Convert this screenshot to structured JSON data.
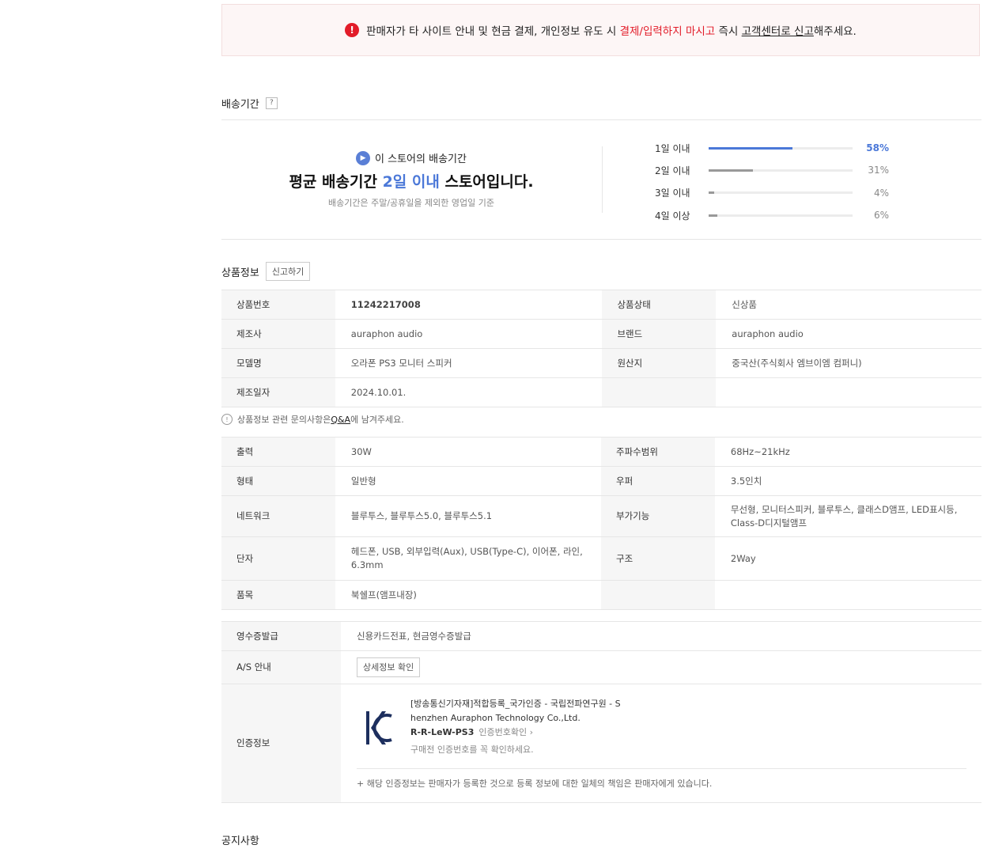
{
  "warning": {
    "icon": "alert-icon",
    "text_a": "판매자가 타 사이트 안내 및 현금 결제, 개인정보 유도 시 ",
    "text_red": "결제/입력하지 마시고",
    "text_b": " 즉시 ",
    "text_ul": "고객센터로 신고",
    "text_c": "해주세요."
  },
  "delivery": {
    "title": "배송기간",
    "help": "?",
    "sub": "이 스토어의 배송기간",
    "big_a": "평균 배송기간 ",
    "big_hl": "2일 이내",
    "big_b": " 스토어입니다.",
    "note": "배송기간은 주말/공휴일을 제외한 영업일 기준",
    "bars": [
      {
        "label": "1일 이내",
        "pct_text": "58%",
        "value": 58
      },
      {
        "label": "2일 이내",
        "pct_text": "31%",
        "value": 31
      },
      {
        "label": "3일 이내",
        "pct_text": "4%",
        "value": 4
      },
      {
        "label": "4일 이상",
        "pct_text": "6%",
        "value": 6
      }
    ]
  },
  "product": {
    "title": "상품정보",
    "report": "신고하기",
    "rows1": [
      [
        "상품번호",
        "11242217008",
        "상품상태",
        "신상품"
      ],
      [
        "제조사",
        "auraphon audio",
        "브랜드",
        "auraphon audio"
      ],
      [
        "모델명",
        "오라폰 PS3 모니터 스피커",
        "원산지",
        "중국산(주식회사 엠브이엠 컴퍼니)"
      ],
      [
        "제조일자",
        "2024.10.01.",
        "",
        ""
      ]
    ],
    "qa_a": "상품정보 관련 문의사항은 ",
    "qa_link": "Q&A",
    "qa_b": "에 남겨주세요.",
    "rows2": [
      [
        "출력",
        "30W",
        "주파수범위",
        "68Hz~21kHz"
      ],
      [
        "형태",
        "일반형",
        "우퍼",
        "3.5인치"
      ],
      [
        "네트워크",
        "블루투스, 블루투스5.0, 블루투스5.1",
        "부가기능",
        "무선형, 모니터스피커, 블루투스, 클래스D앰프, LED표시등, Class-D디지털앰프"
      ],
      [
        "단자",
        "헤드폰, USB, 외부입력(Aux), USB(Type-C), 이어폰, 라인, 6.3mm",
        "구조",
        "2Way"
      ],
      [
        "품목",
        "북쉘프(앰프내장)",
        "",
        ""
      ]
    ],
    "receipt_label": "영수증발급",
    "receipt_value": "신용카드전표, 현금영수증발급",
    "as_label": "A/S 안내",
    "as_button": "상세정보 확인",
    "cert_label": "인증정보",
    "cert_line1": "[방송통신기자재]적합등록_국가인증 - 국립전파연구원 - S",
    "cert_line2": "henzhen Auraphon Technology Co.,Ltd.",
    "cert_code": "R-R-LeW-PS3",
    "cert_link": "인증번호확인 ›",
    "cert_warn": "구매전 인증번호를 꼭 확인하세요.",
    "cert_foot": "+ 해당 인증정보는 판매자가 등록한 것으로 등록 정보에 대한 일체의 책임은 판매자에게 있습니다."
  },
  "notice_title": "공지사항"
}
